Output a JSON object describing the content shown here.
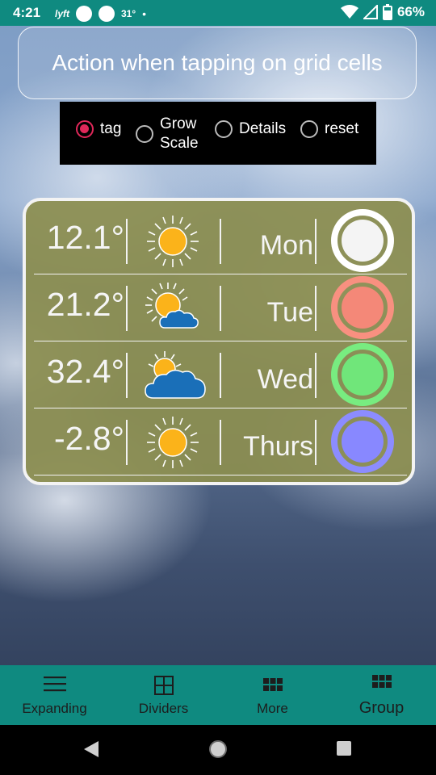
{
  "status_bar": {
    "time": "4:21",
    "notification_app": "lyft",
    "temperature": "31°",
    "battery": "66%"
  },
  "title": "Action when tapping on grid cells",
  "radio_options": [
    {
      "label": "tag",
      "checked": true
    },
    {
      "label_line1": "Grow",
      "label_line2": "Scale",
      "checked": false
    },
    {
      "label": "Details",
      "checked": false
    },
    {
      "label": "reset",
      "checked": false
    }
  ],
  "weather_rows": [
    {
      "temp": "12.1°",
      "day": "Mon",
      "icon": "sun-icon",
      "ring_color": "#ffffff",
      "fill_color": "#f4f4f4"
    },
    {
      "temp": "21.2°",
      "day": "Tue",
      "icon": "sun-cloud-icon",
      "ring_color": "#f89080",
      "fill_color": "#f48878"
    },
    {
      "temp": "32.4°",
      "day": "Wed",
      "icon": "cloud-sun-icon",
      "ring_color": "#78ec80",
      "fill_color": "#70e67a"
    },
    {
      "temp": "-2.8°",
      "day": "Thurs",
      "icon": "sun-icon",
      "ring_color": "#8c8cff",
      "fill_color": "#8888ff"
    }
  ],
  "bottom_nav": [
    {
      "label": "Expanding",
      "icon": "menu-icon"
    },
    {
      "label": "Dividers",
      "icon": "grid-dividers-icon"
    },
    {
      "label": "More",
      "icon": "more-grid-icon"
    },
    {
      "label": "Group",
      "icon": "group-grid-icon"
    }
  ],
  "colors": {
    "accent": "#0f8a80",
    "radio_checked": "#e0285a",
    "grid_background": "#8c8e50"
  }
}
